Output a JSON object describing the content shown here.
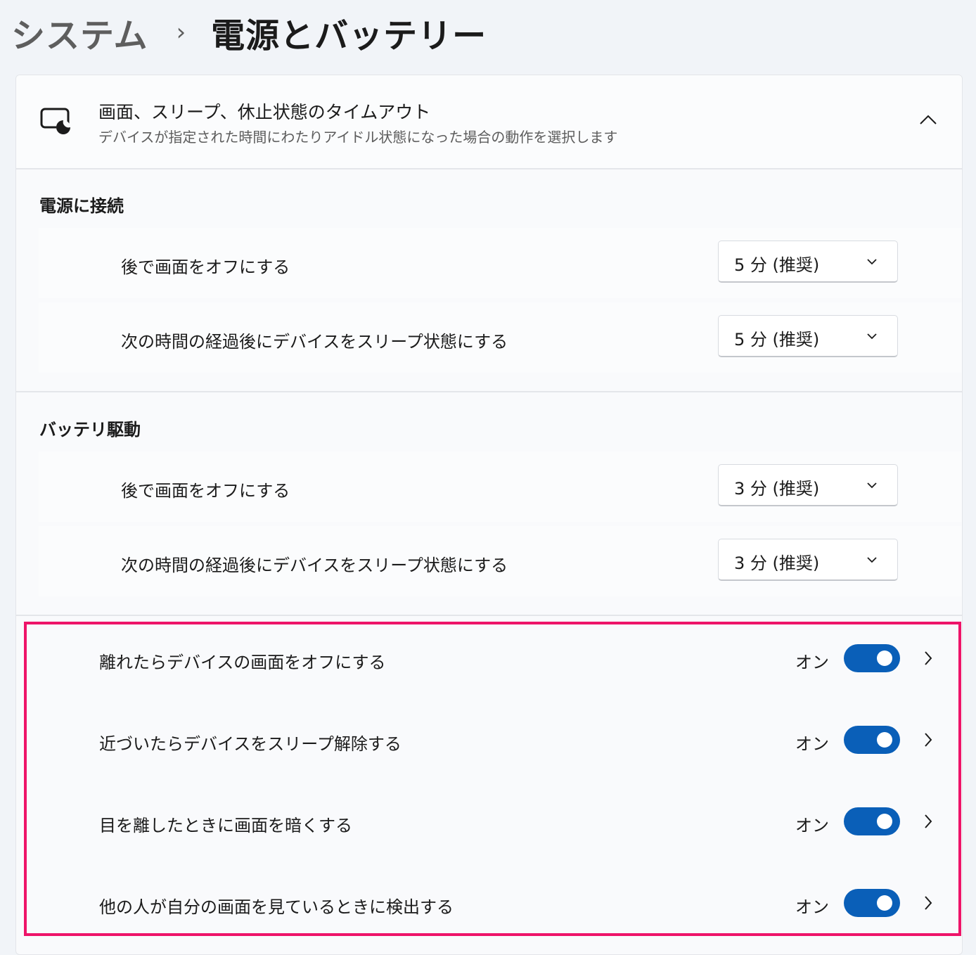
{
  "breadcrumb": {
    "parent": "システム",
    "separator": "›",
    "current": "電源とバッテリー"
  },
  "timeout_card": {
    "icon": "screen-sleep-icon",
    "title": "画面、スリープ、休止状態のタイムアウト",
    "description": "デバイスが指定された時間にわたりアイドル状態になった場合の動作を選択します",
    "expanded": true,
    "sections": [
      {
        "title": "電源に接続",
        "rows": [
          {
            "label": "後で画面をオフにする",
            "value": "5 分 (推奨)"
          },
          {
            "label": "次の時間の経過後にデバイスをスリープ状態にする",
            "value": "5 分 (推奨)"
          }
        ]
      },
      {
        "title": "バッテリ駆動",
        "rows": [
          {
            "label": "後で画面をオフにする",
            "value": "3 分 (推奨)"
          },
          {
            "label": "次の時間の経過後にデバイスをスリープ状態にする",
            "value": "3 分 (推奨)"
          }
        ]
      }
    ]
  },
  "presence_settings": [
    {
      "label": "離れたらデバイスの画面をオフにする",
      "state": "オン",
      "on": true
    },
    {
      "label": "近づいたらデバイスをスリープ解除する",
      "state": "オン",
      "on": true
    },
    {
      "label": "目を離したときに画面を暗くする",
      "state": "オン",
      "on": true
    },
    {
      "label": "他の人が自分の画面を見ているときに検出する",
      "state": "オン",
      "on": true
    }
  ],
  "colors": {
    "accent": "#0a5fb8",
    "highlight": "#ee1469",
    "background": "#f1f4f8",
    "card": "#f9fafc"
  }
}
